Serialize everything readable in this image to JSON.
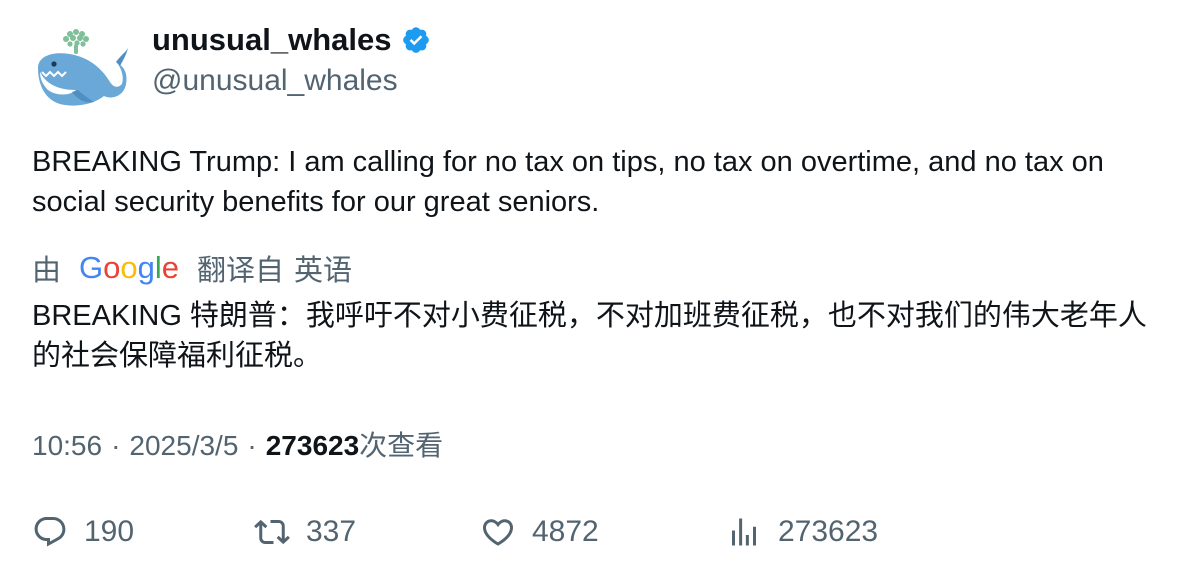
{
  "author": {
    "display_name": "unusual_whales",
    "handle": "@unusual_whales",
    "verified": true,
    "verified_color": "#1d9bf0"
  },
  "tweet": {
    "text": "BREAKING Trump: I am calling for no tax on tips, no tax on overtime, and no tax on social security benefits for our great seniors."
  },
  "translation": {
    "by_label": "由",
    "provider": "Google",
    "from_label": "翻译自",
    "language": "英语",
    "text": "BREAKING 特朗普：我呼吁不对小费征税，不对加班费征税，也不对我们的伟大老年人的社会保障福利征税。"
  },
  "meta": {
    "time": "10:56",
    "separator": "·",
    "date": "2025/3/5",
    "views_count": "273623",
    "views_label": "次查看"
  },
  "actions": {
    "reply": {
      "icon": "reply-icon",
      "count": "190"
    },
    "retweet": {
      "icon": "retweet-icon",
      "count": "337"
    },
    "like": {
      "icon": "heart-icon",
      "count": "4872"
    },
    "views": {
      "icon": "bar-chart-icon",
      "count": "273623"
    }
  }
}
